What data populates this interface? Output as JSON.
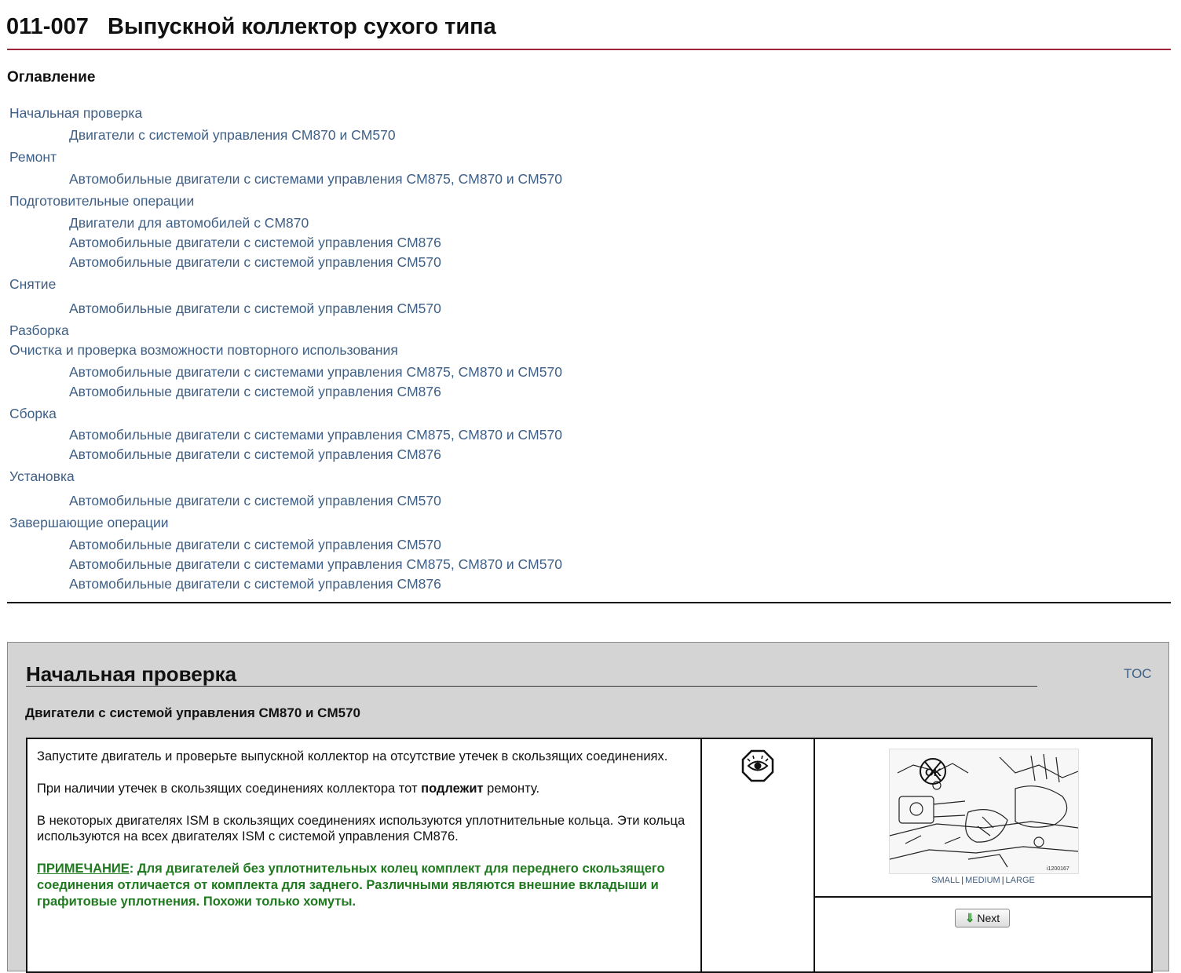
{
  "document": {
    "code": "011-007",
    "title": "Выпускной коллектор сухого типа"
  },
  "toc": {
    "heading": "Оглавление",
    "items": [
      {
        "label": "Начальная проверка",
        "level": 1
      },
      {
        "label": "Двигатели с системой управления CM870 и CM570",
        "level": 2
      },
      {
        "label": "Ремонт",
        "level": 1
      },
      {
        "label": "Автомобильные двигатели с системами управления CM875, CM870 и CM570",
        "level": 2
      },
      {
        "label": "Подготовительные операции",
        "level": 1
      },
      {
        "label": "Двигатели для автомобилей с CM870",
        "level": 2
      },
      {
        "label": "Автомобильные двигатели с системой управления CM876",
        "level": 2
      },
      {
        "label": "Автомобильные двигатели с системой управления CM570",
        "level": 2
      },
      {
        "label": "Снятие",
        "level": 1
      },
      {
        "label": "Автомобильные двигатели с системой управления CM570",
        "level": 2
      },
      {
        "label": "Разборка",
        "level": 1
      },
      {
        "label": "Очистка и проверка возможности повторного использования",
        "level": 1
      },
      {
        "label": "Автомобильные двигатели с системами управления CM875, CM870 и CM570",
        "level": 2
      },
      {
        "label": "Автомобильные двигатели с системой управления CM876",
        "level": 2
      },
      {
        "label": "Сборка",
        "level": 1
      },
      {
        "label": "Автомобильные двигатели с системами управления CM875, CM870 и CM570",
        "level": 2
      },
      {
        "label": "Автомобильные двигатели с системой управления CM876",
        "level": 2
      },
      {
        "label": "Установка",
        "level": 1
      },
      {
        "label": "Автомобильные двигатели с системой управления CM570",
        "level": 2
      },
      {
        "label": "Завершающие операции",
        "level": 1
      },
      {
        "label": "Автомобильные двигатели с системой управления CM570",
        "level": 2
      },
      {
        "label": "Автомобильные двигатели с системами управления CM875, CM870 и CM570",
        "level": 2
      },
      {
        "label": "Автомобильные двигатели с системой управления CM876",
        "level": 2
      }
    ]
  },
  "section": {
    "title": "Начальная проверка",
    "toc_link": "TOC",
    "subtitle": "Двигатели с системой управления CM870 и CM570",
    "paragraph1": "Запустите двигатель и проверьте выпускной коллектор на отсутствие утечек в скользящих соединениях.",
    "paragraph2_before": "При наличии утечек в скользящих соединениях коллектора тот ",
    "paragraph2_bold": "подлежит",
    "paragraph2_after": " ремонту.",
    "paragraph3": "В некоторых двигателях ISM в скользящих соединениях используются уплотнительные кольца. Эти кольца используются на всех двигателях ISM с системой управления CM876.",
    "note_label": "ПРИМЕЧАНИЕ",
    "note_colon": ":",
    "note_text": " Для двигателей без уплотнительных колец комплект для переднего скользящего соединения отличается от комплекта для заднего. Различными являются внешние вкладыши и графитовые уплотнения. Похожи только хомуты.",
    "icon": "eye-inspect-icon",
    "figure_id": "i1200167",
    "figure_mark": "OK",
    "size_small": "SMALL",
    "size_medium": "MEDIUM",
    "size_large": "LARGE",
    "size_sep": "|",
    "next_arrow": "⇓",
    "next_label": "Next"
  },
  "colors": {
    "link": "#3f5f85",
    "title_rule": "#a0243c",
    "note": "#1f7a1f",
    "panel_bg": "#d4d4d4"
  }
}
